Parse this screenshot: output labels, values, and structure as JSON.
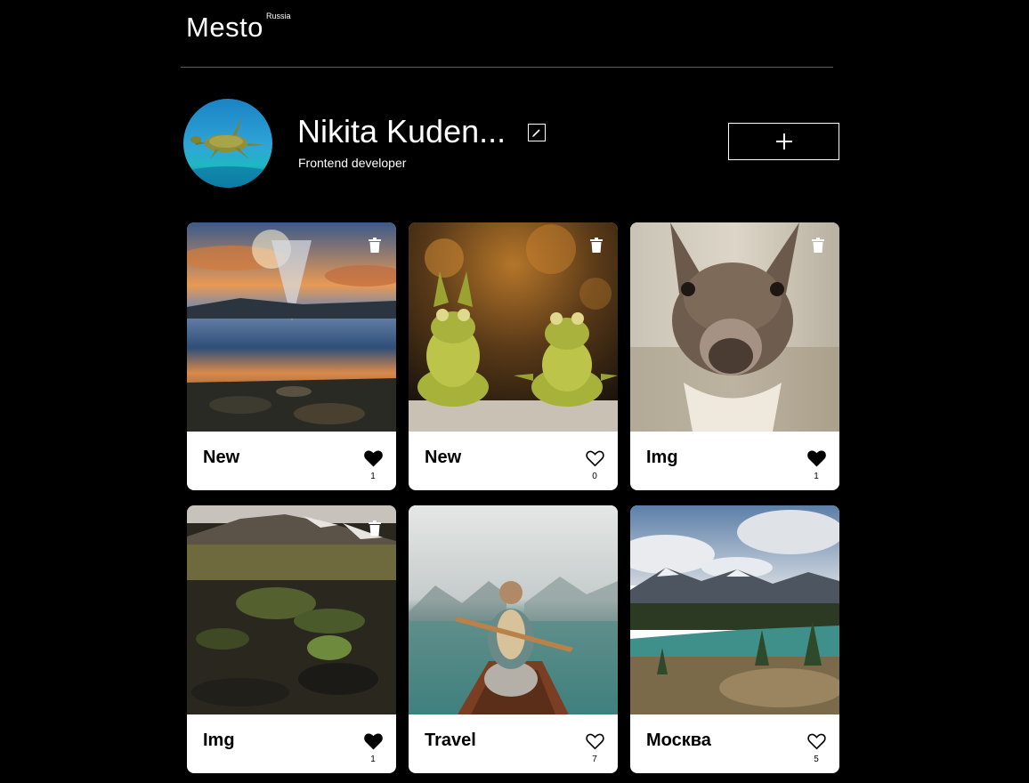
{
  "header": {
    "logo": "Mesto",
    "logo_sup": "Russia"
  },
  "profile": {
    "name": "Nikita Kuden...",
    "about": "Frontend developer",
    "add_label": "+"
  },
  "colors": {
    "background": "#000000",
    "card_background": "#ffffff",
    "divider": "#5f5f5f"
  },
  "cards": [
    {
      "title": "New",
      "likes": "1",
      "liked": true,
      "trash": true,
      "image": "mountain-lake-sunset"
    },
    {
      "title": "New",
      "likes": "0",
      "liked": false,
      "trash": true,
      "image": "frog-figurines"
    },
    {
      "title": "Img",
      "likes": "1",
      "liked": true,
      "trash": true,
      "image": "llama"
    },
    {
      "title": "Img",
      "likes": "1",
      "liked": true,
      "trash": true,
      "image": "tundra-volcano"
    },
    {
      "title": "Travel",
      "likes": "7",
      "liked": false,
      "trash": false,
      "image": "canoe-on-lake"
    },
    {
      "title": "Москва",
      "likes": "5",
      "liked": false,
      "trash": false,
      "image": "mountain-river-valley"
    }
  ]
}
